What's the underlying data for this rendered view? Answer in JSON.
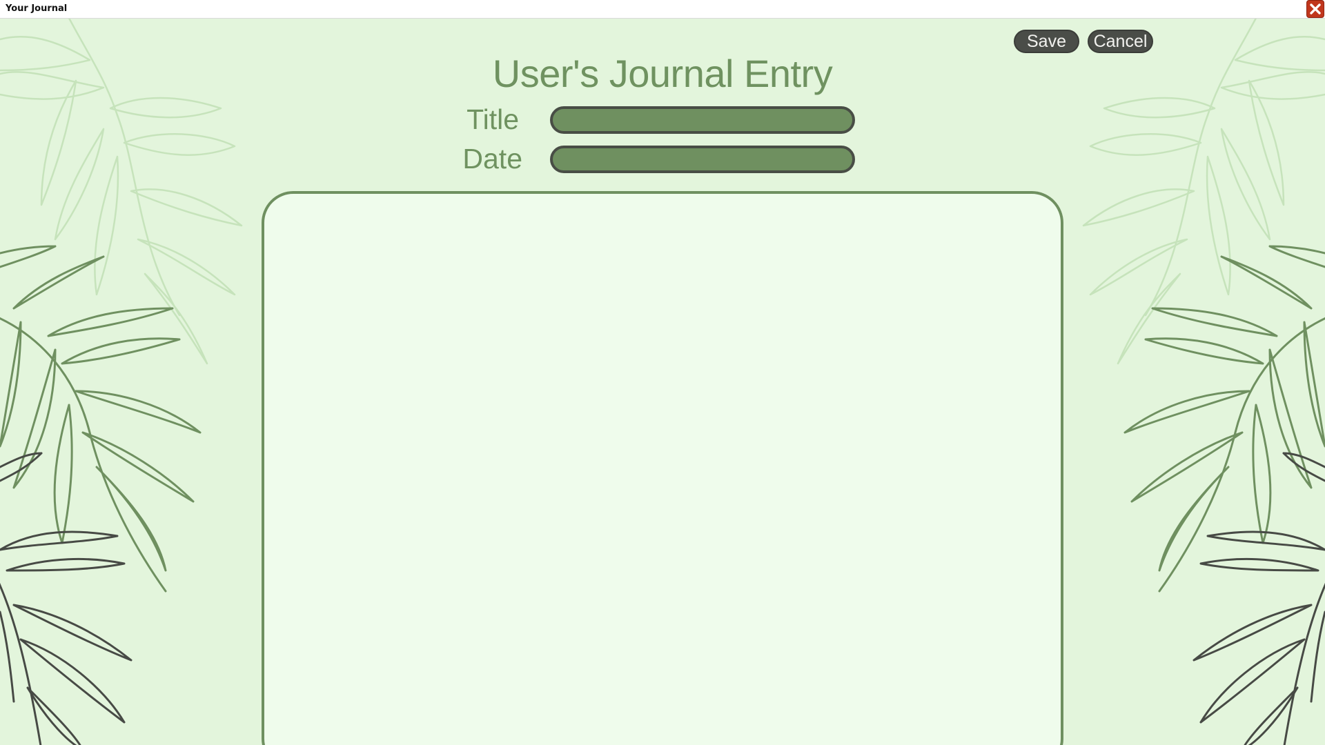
{
  "window": {
    "title": "Your Journal",
    "close_icon": "close-icon"
  },
  "toolbar": {
    "save_label": "Save",
    "cancel_label": "Cancel"
  },
  "page": {
    "heading": "User's Journal Entry"
  },
  "form": {
    "title_label": "Title",
    "title_value": "",
    "date_label": "Date",
    "date_value": "",
    "entry_value": ""
  },
  "colors": {
    "background": "#e3f5dc",
    "accent_green": "#6f9060",
    "button_dark": "#4a4d48",
    "entry_background": "#effcec",
    "close_red": "#c0361c"
  },
  "decorations": {
    "left": "leaf-decoration",
    "right": "leaf-decoration"
  }
}
